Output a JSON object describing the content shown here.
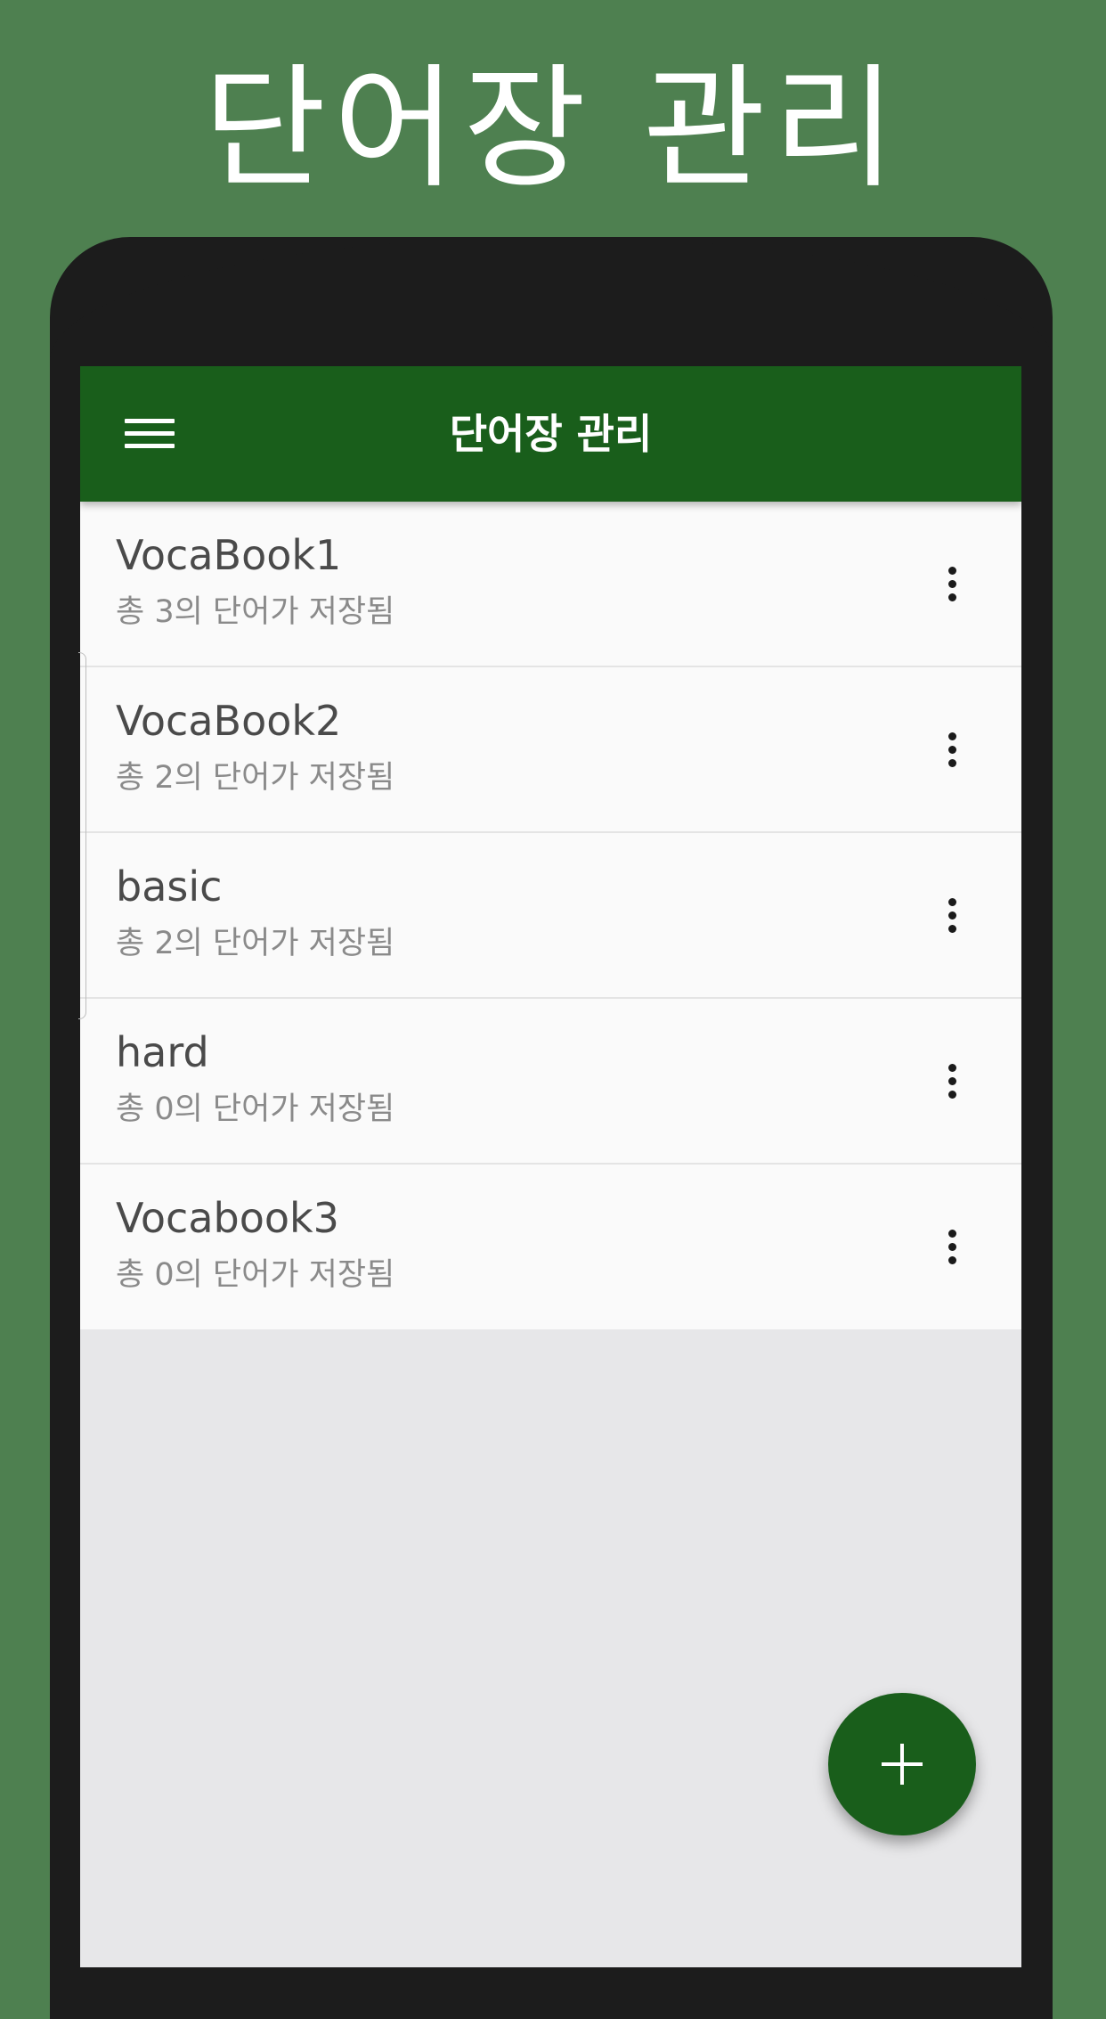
{
  "promo": {
    "title": "단어장 관리"
  },
  "app_bar": {
    "title": "단어장 관리",
    "menu_icon": "hamburger-menu-icon"
  },
  "vocab_books": [
    {
      "name": "VocaBook1",
      "summary": "총 3의 단어가 저장됨"
    },
    {
      "name": "VocaBook2",
      "summary": "총 2의 단어가 저장됨"
    },
    {
      "name": "basic",
      "summary": "총 2의 단어가 저장됨"
    },
    {
      "name": "hard",
      "summary": "총 0의 단어가 저장됨"
    },
    {
      "name": "Vocabook3",
      "summary": "총 0의 단어가 저장됨"
    }
  ],
  "item_action_icon": "more-vertical-icon",
  "fab": {
    "icon": "plus-icon"
  },
  "colors": {
    "background": "#4e8050",
    "primary": "#195e1b",
    "bezel": "#1c1c1c",
    "list_background": "#fafafa",
    "screen_background": "#e7e7e9"
  }
}
